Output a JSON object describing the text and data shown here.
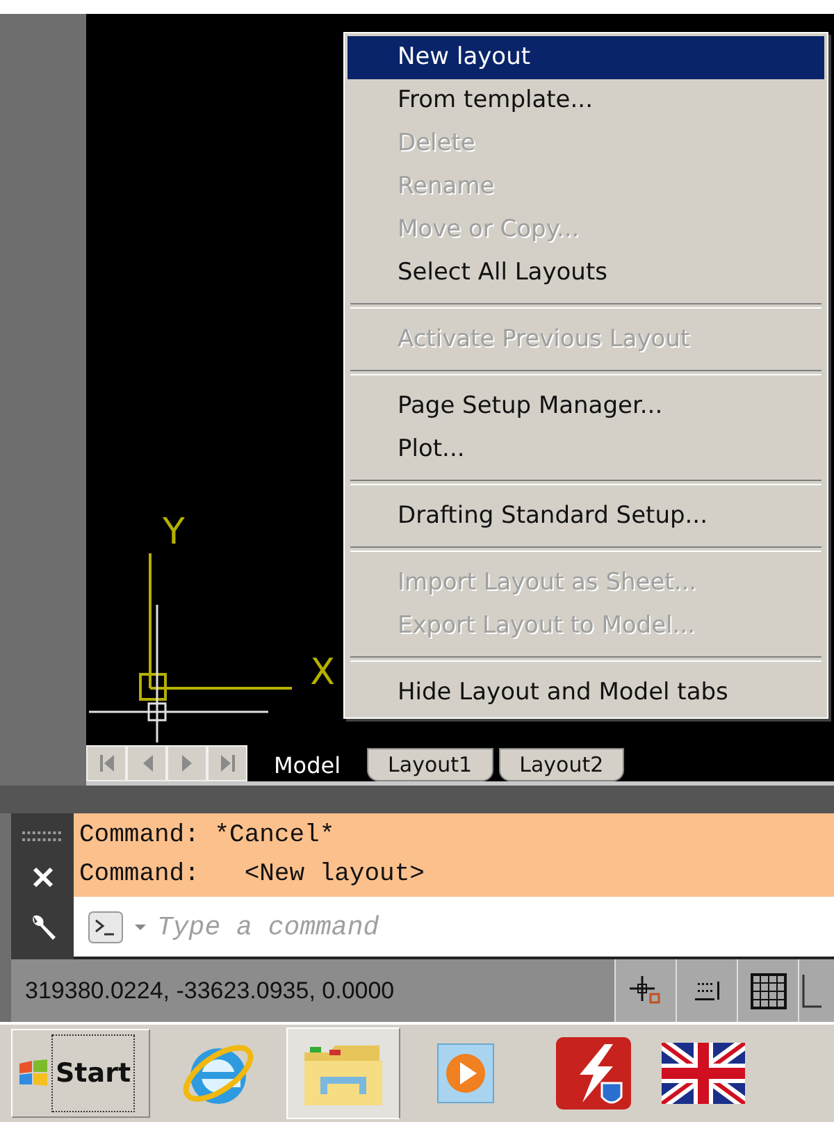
{
  "layout_tabs": [
    {
      "label": "Model",
      "selected": true
    },
    {
      "label": "Layout1",
      "selected": false
    },
    {
      "label": "Layout2",
      "selected": false
    }
  ],
  "context_menu": {
    "items": [
      {
        "kind": "item",
        "label": "New layout",
        "selected": true,
        "disabled": false
      },
      {
        "kind": "item",
        "label": "From template...",
        "selected": false,
        "disabled": false
      },
      {
        "kind": "item",
        "label": "Delete",
        "selected": false,
        "disabled": true
      },
      {
        "kind": "item",
        "label": "Rename",
        "selected": false,
        "disabled": true
      },
      {
        "kind": "item",
        "label": "Move or Copy...",
        "selected": false,
        "disabled": true
      },
      {
        "kind": "item",
        "label": "Select All Layouts",
        "selected": false,
        "disabled": false
      },
      {
        "kind": "separator"
      },
      {
        "kind": "item",
        "label": "Activate Previous Layout",
        "selected": false,
        "disabled": true
      },
      {
        "kind": "separator"
      },
      {
        "kind": "item",
        "label": "Page Setup Manager...",
        "selected": false,
        "disabled": false
      },
      {
        "kind": "item",
        "label": "Plot...",
        "selected": false,
        "disabled": false
      },
      {
        "kind": "separator"
      },
      {
        "kind": "item",
        "label": "Drafting Standard Setup...",
        "selected": false,
        "disabled": false
      },
      {
        "kind": "separator"
      },
      {
        "kind": "item",
        "label": "Import Layout as Sheet...",
        "selected": false,
        "disabled": true
      },
      {
        "kind": "item",
        "label": "Export Layout to Model...",
        "selected": false,
        "disabled": true
      },
      {
        "kind": "separator"
      },
      {
        "kind": "item",
        "label": "Hide Layout and Model tabs",
        "selected": false,
        "disabled": false
      }
    ]
  },
  "ucs_icon": {
    "x_label": "X",
    "y_label": "Y"
  },
  "command_history": [
    "Command: *Cancel*",
    "Command:   <New layout>"
  ],
  "command_line": {
    "placeholder": "Type a command"
  },
  "status_bar": {
    "coordinates": "319380.0224, -33623.0935, 0.0000"
  },
  "taskbar": {
    "start_label": "Start"
  }
}
